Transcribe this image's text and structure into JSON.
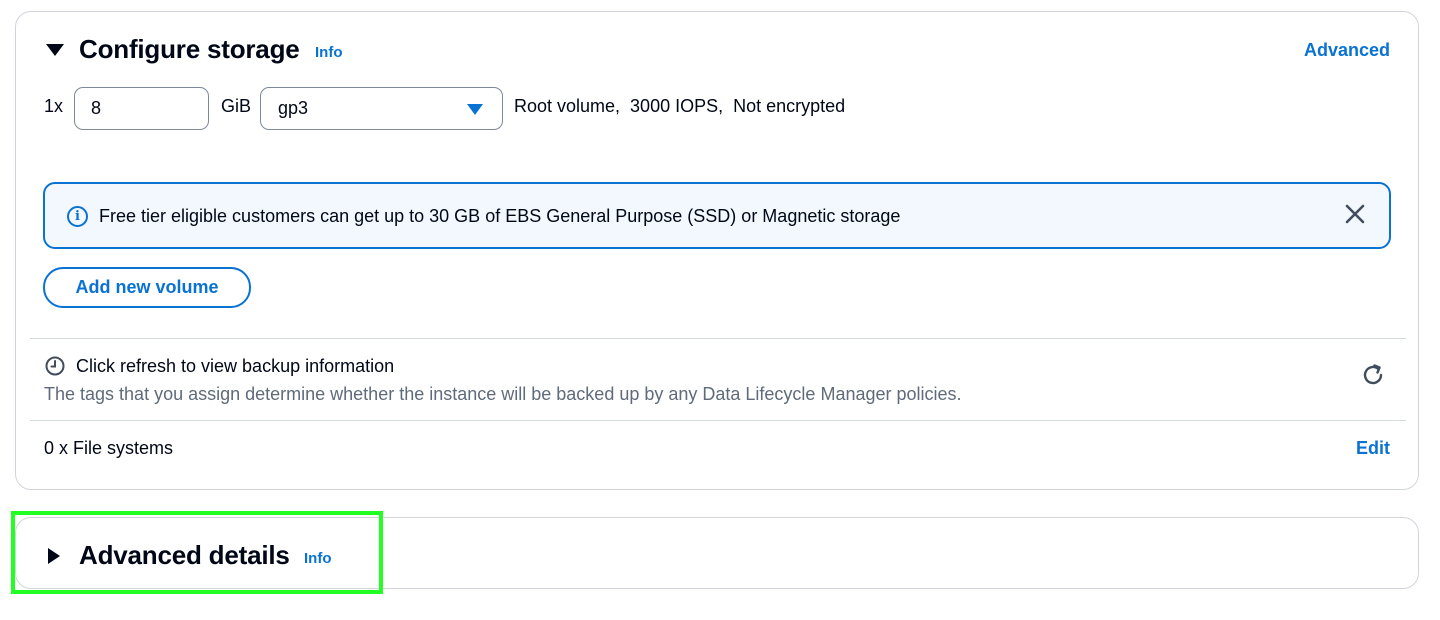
{
  "storage": {
    "title": "Configure storage",
    "info_label": "Info",
    "advanced_label": "Advanced",
    "volume": {
      "multiplier": "1x",
      "size_value": "8",
      "unit": "GiB",
      "volume_type": "gp3",
      "description": "Root volume,  3000 IOPS,  Not encrypted"
    },
    "alert": {
      "icon": "info-circle-icon",
      "text": "Free tier eligible customers can get up to 30 GB of EBS General Purpose (SSD) or Magnetic storage",
      "close_icon": "close-icon"
    },
    "add_volume_label": "Add new volume",
    "backup": {
      "icon": "clock-icon",
      "title": "Click refresh to view backup information",
      "description": "The tags that you assign determine whether the instance will be backed up by any Data Lifecycle Manager policies.",
      "refresh_icon": "refresh-icon"
    },
    "file_systems": {
      "label": "0 x File systems",
      "edit_label": "Edit"
    }
  },
  "advanced_details": {
    "title": "Advanced details",
    "info_label": "Info"
  },
  "colors": {
    "link": "#0972d3",
    "text": "#000716",
    "alert_bg": "#f2f8fd",
    "highlight": "#22ff22"
  }
}
